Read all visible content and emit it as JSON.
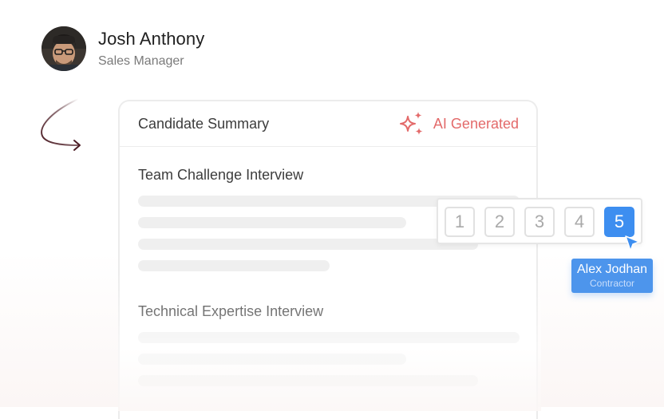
{
  "profile": {
    "name": "Josh Anthony",
    "role": "Sales Manager"
  },
  "card": {
    "title": "Candidate Summary",
    "badge": "AI Generated",
    "sections": [
      {
        "title": "Team Challenge Interview"
      },
      {
        "title": "Technical Expertise Interview"
      }
    ]
  },
  "rating": {
    "options": [
      "1",
      "2",
      "3",
      "4",
      "5"
    ],
    "selected": "5"
  },
  "tooltip": {
    "name": "Alex Jodhan",
    "role": "Contractor"
  },
  "colors": {
    "accent": "#3d8ef0",
    "ai": "#e36a6a"
  }
}
